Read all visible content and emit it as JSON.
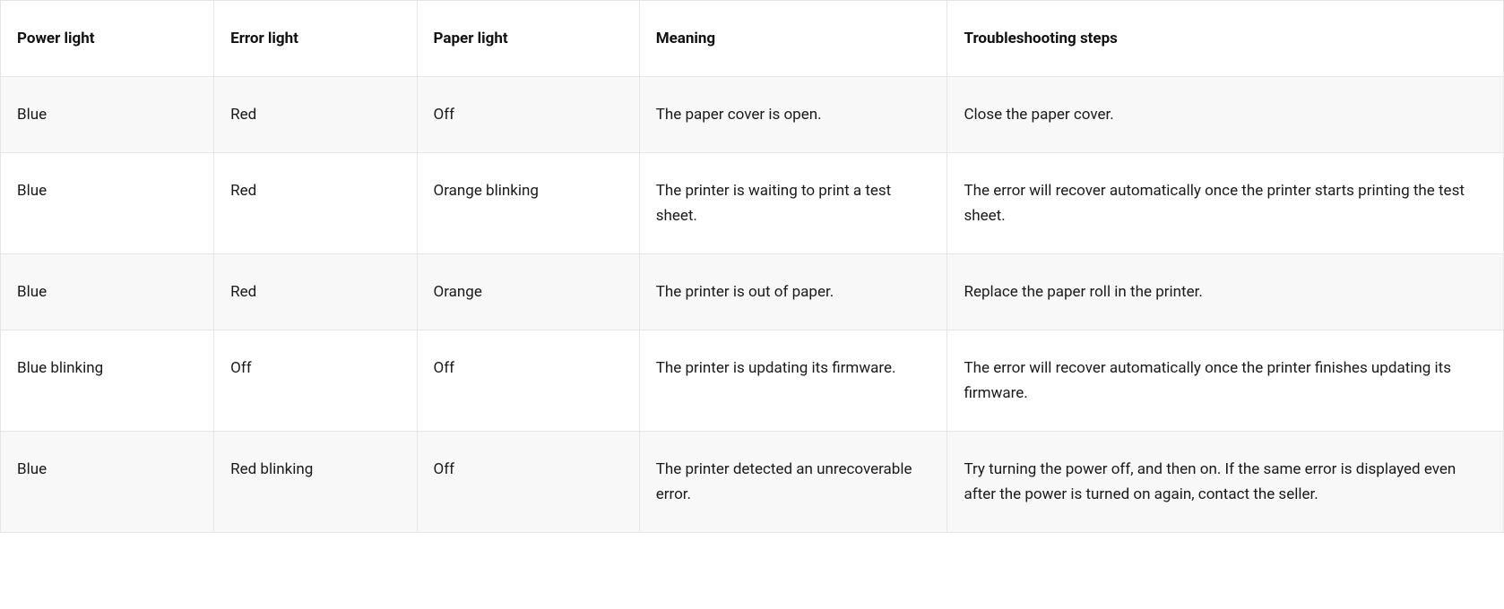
{
  "table": {
    "headers": {
      "power": "Power light",
      "error": "Error light",
      "paper": "Paper light",
      "meaning": "Meaning",
      "steps": "Troubleshooting steps"
    },
    "rows": [
      {
        "power": "Blue",
        "error": "Red",
        "paper": "Off",
        "meaning": "The paper cover is open.",
        "steps": "Close the paper cover."
      },
      {
        "power": "Blue",
        "error": "Red",
        "paper": "Orange blinking",
        "meaning": "The printer is waiting to print a test sheet.",
        "steps": "The error will recover automatically once the printer starts printing the test sheet."
      },
      {
        "power": "Blue",
        "error": "Red",
        "paper": "Orange",
        "meaning": "The printer is out of paper.",
        "steps": "Replace the paper roll in the printer."
      },
      {
        "power": "Blue blinking",
        "error": "Off",
        "paper": "Off",
        "meaning": "The printer is updating its firmware.",
        "steps": "The error will recover automatically once the printer finishes updating its firmware."
      },
      {
        "power": "Blue",
        "error": "Red blinking",
        "paper": "Off",
        "meaning": "The printer detected an unrecoverable error.",
        "steps": "Try turning the power off, and then on. If the same error is displayed even after the power is turned on again, contact the seller."
      }
    ]
  }
}
